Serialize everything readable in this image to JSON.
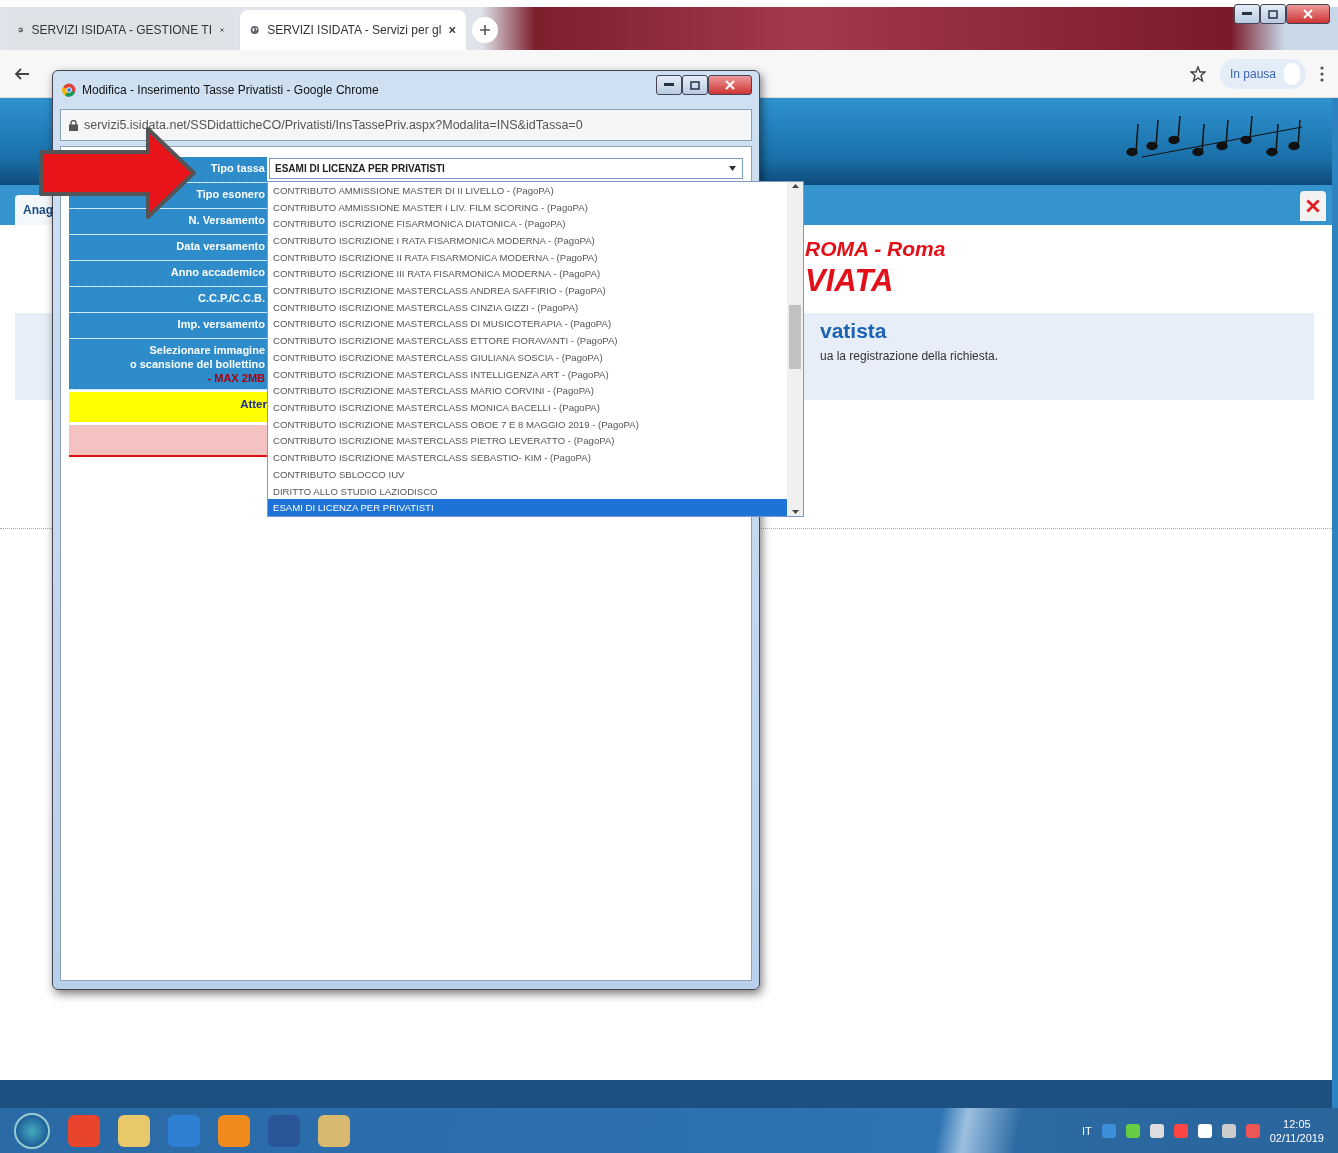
{
  "browser": {
    "tabs": [
      {
        "label": "SERVIZI ISIDATA - GESTIONE TI",
        "selected": false
      },
      {
        "label": "SERVIZI ISIDATA - Servizi per gl",
        "selected": true
      }
    ],
    "profile_label": "In pausa"
  },
  "page": {
    "nav_tab": "Anag",
    "heading": "ROMA - Roma",
    "title": "VIATA",
    "panel_title": "vatista",
    "panel_text": "ua la registrazione della richiesta."
  },
  "popup": {
    "title": "Modifica - Inserimento Tasse Privatisti - Google Chrome",
    "url": "servizi5.isidata.net/SSDidatticheCO/Privatisti/InsTassePriv.aspx?Modalita=INS&idTassa=0",
    "form": {
      "rows": [
        {
          "label_lines": [
            "Tipo tassa"
          ]
        },
        {
          "label_lines": [
            "Tipo esonero"
          ]
        },
        {
          "label_lines": [
            "N. Versamento"
          ]
        },
        {
          "label_lines": [
            "Data versamento"
          ]
        },
        {
          "label_lines": [
            "Anno accademico"
          ]
        },
        {
          "label_lines": [
            "C.C.P./C.C.B."
          ]
        },
        {
          "label_lines": [
            "Imp. versamento"
          ]
        },
        {
          "label_lines": [
            "Selezionare immagine",
            "o scansione del bollettino"
          ],
          "note": "- MAX 2MB"
        }
      ],
      "warning": "Atter"
    },
    "select": {
      "value": "ESAMI DI LICENZA PER PRIVATISTI",
      "options": [
        {
          "label": "CONTRIBUTO AMMISSIONE MASTER DI II LIVELLO - (PagoPA)",
          "selected": false
        },
        {
          "label": "CONTRIBUTO AMMISSIONE MASTER I LIV. FILM SCORING - (PagoPA)",
          "selected": false
        },
        {
          "label": "CONTRIBUTO ISCRIZIONE FISARMONICA DIATONICA - (PagoPA)",
          "selected": false
        },
        {
          "label": "CONTRIBUTO ISCRIZIONE I RATA FISARMONICA MODERNA - (PagoPA)",
          "selected": false
        },
        {
          "label": "CONTRIBUTO ISCRIZIONE II RATA FISARMONICA MODERNA - (PagoPA)",
          "selected": false
        },
        {
          "label": "CONTRIBUTO ISCRIZIONE III RATA FISARMONICA MODERNA - (PagoPA)",
          "selected": false
        },
        {
          "label": "CONTRIBUTO ISCRIZIONE MASTERCLASS ANDREA SAFFIRIO - (PagoPA)",
          "selected": false
        },
        {
          "label": "CONTRIBUTO ISCRIZIONE MASTERCLASS CINZIA GIZZI - (PagoPA)",
          "selected": false
        },
        {
          "label": "CONTRIBUTO ISCRIZIONE MASTERCLASS DI MUSICOTERAPIA - (PagoPA)",
          "selected": false
        },
        {
          "label": "CONTRIBUTO ISCRIZIONE MASTERCLASS ETTORE FIORAVANTI - (PagoPA)",
          "selected": false
        },
        {
          "label": "CONTRIBUTO ISCRIZIONE MASTERCLASS GIULIANA SOSCIA - (PagoPA)",
          "selected": false
        },
        {
          "label": "CONTRIBUTO ISCRIZIONE MASTERCLASS INTELLIGENZA ART - (PagoPA)",
          "selected": false
        },
        {
          "label": "CONTRIBUTO ISCRIZIONE MASTERCLASS MARIO CORVINI - (PagoPA)",
          "selected": false
        },
        {
          "label": "CONTRIBUTO ISCRIZIONE MASTERCLASS MONICA BACELLI - (PagoPA)",
          "selected": false
        },
        {
          "label": "CONTRIBUTO ISCRIZIONE MASTERCLASS OBOE 7 E 8 MAGGIO 2019 - (PagoPA)",
          "selected": false
        },
        {
          "label": "CONTRIBUTO ISCRIZIONE MASTERCLASS PIETRO LEVERATTO - (PagoPA)",
          "selected": false
        },
        {
          "label": "CONTRIBUTO ISCRIZIONE MASTERCLASS SEBASTIO- KIM - (PagoPA)",
          "selected": false
        },
        {
          "label": "CONTRIBUTO SBLOCCO IUV",
          "selected": false
        },
        {
          "label": "DIRITTO ALLO STUDIO LAZIODISCO",
          "selected": false
        },
        {
          "label": "ESAMI DI LICENZA PER PRIVATISTI",
          "selected": true
        }
      ]
    }
  },
  "taskbar": {
    "language": "IT",
    "time": "12:05",
    "date": "02/11/2019"
  }
}
